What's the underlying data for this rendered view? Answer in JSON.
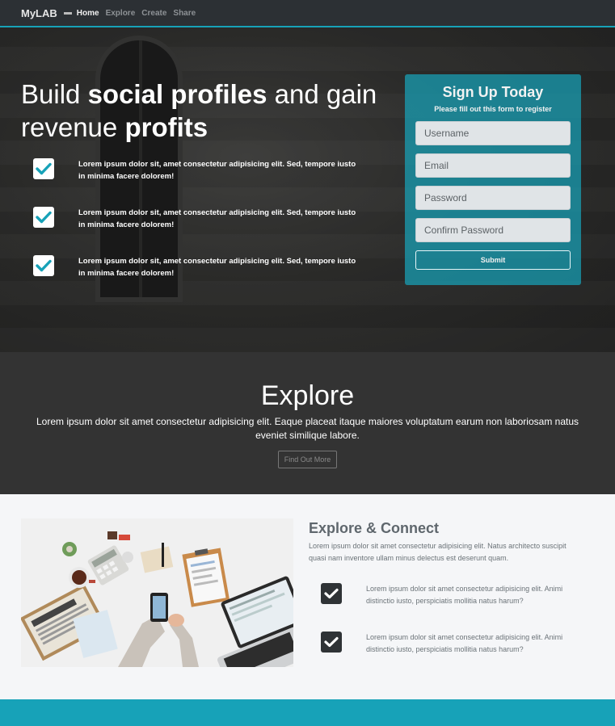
{
  "nav": {
    "brand": "MyLAB",
    "links": [
      "Home",
      "Explore",
      "Create",
      "Share"
    ]
  },
  "hero": {
    "title_pre": "Build ",
    "title_bold1": "social profiles",
    "title_mid": " and gain revenue ",
    "title_bold2": "profits",
    "items": [
      "Lorem ipsum dolor sit, amet consectetur adipisicing elit. Sed, tempore iusto in minima facere dolorem!",
      "Lorem ipsum dolor sit, amet consectetur adipisicing elit. Sed, tempore iusto in minima facere dolorem!",
      "Lorem ipsum dolor sit, amet consectetur adipisicing elit. Sed, tempore iusto in minima facere dolorem!"
    ]
  },
  "signup": {
    "title": "Sign Up Today",
    "subtitle": "Please fill out this form to register",
    "username_placeholder": "Username",
    "email_placeholder": "Email",
    "password_placeholder": "Password",
    "confirm_placeholder": "Confirm Password",
    "submit_label": "Submit"
  },
  "explore": {
    "title": "Explore",
    "text": "Lorem ipsum dolor sit amet consectetur adipisicing elit. Eaque placeat itaque maiores voluptatum earum non laboriosam natus eveniet similique labore.",
    "button_label": "Find Out More"
  },
  "connect": {
    "title": "Explore & Connect",
    "text": "Lorem ipsum dolor sit amet consectetur adipisicing elit. Natus architecto suscipit quasi nam inventore ullam minus delectus est deserunt quam.",
    "items": [
      "Lorem ipsum dolor sit amet consectetur adipisicing elit. Animi distinctio iusto, perspiciatis mollitia natus harum?",
      "Lorem ipsum dolor sit amet consectetur adipisicing elit. Animi distinctio iusto, perspiciatis mollitia natus harum?"
    ]
  },
  "colors": {
    "accent": "#17a2b8",
    "navbar": "#2c3034",
    "explore_bg": "#333333"
  },
  "icons": {
    "check": "check-icon"
  }
}
